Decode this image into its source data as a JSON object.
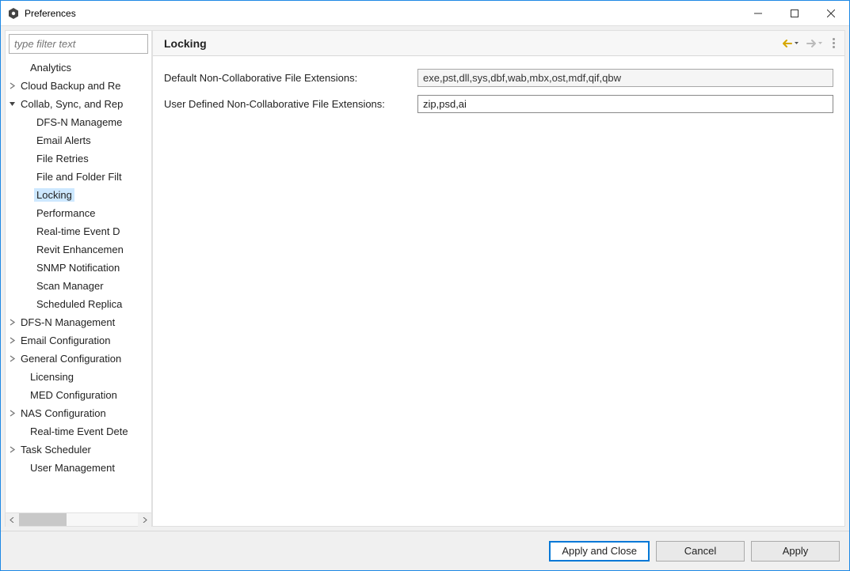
{
  "window": {
    "title": "Preferences"
  },
  "sidebar": {
    "filter_placeholder": "type filter text",
    "items": [
      {
        "label": "Analytics",
        "level": 0,
        "children": false,
        "expanded": false,
        "selected": false
      },
      {
        "label": "Cloud Backup and Re",
        "level": 0,
        "children": true,
        "expanded": false,
        "selected": false
      },
      {
        "label": "Collab, Sync, and Rep",
        "level": 0,
        "children": true,
        "expanded": true,
        "selected": false
      },
      {
        "label": "DFS-N Manageme",
        "level": 1,
        "children": false,
        "expanded": false,
        "selected": false
      },
      {
        "label": "Email Alerts",
        "level": 1,
        "children": false,
        "expanded": false,
        "selected": false
      },
      {
        "label": "File Retries",
        "level": 1,
        "children": false,
        "expanded": false,
        "selected": false
      },
      {
        "label": "File and Folder Filt",
        "level": 1,
        "children": false,
        "expanded": false,
        "selected": false
      },
      {
        "label": "Locking",
        "level": 1,
        "children": false,
        "expanded": false,
        "selected": true
      },
      {
        "label": "Performance",
        "level": 1,
        "children": false,
        "expanded": false,
        "selected": false
      },
      {
        "label": "Real-time Event D",
        "level": 1,
        "children": false,
        "expanded": false,
        "selected": false
      },
      {
        "label": "Revit Enhancemen",
        "level": 1,
        "children": false,
        "expanded": false,
        "selected": false
      },
      {
        "label": "SNMP Notification",
        "level": 1,
        "children": false,
        "expanded": false,
        "selected": false
      },
      {
        "label": "Scan Manager",
        "level": 1,
        "children": false,
        "expanded": false,
        "selected": false
      },
      {
        "label": "Scheduled Replica",
        "level": 1,
        "children": false,
        "expanded": false,
        "selected": false
      },
      {
        "label": "DFS-N Management",
        "level": 0,
        "children": true,
        "expanded": false,
        "selected": false
      },
      {
        "label": "Email Configuration",
        "level": 0,
        "children": true,
        "expanded": false,
        "selected": false
      },
      {
        "label": "General Configuration",
        "level": 0,
        "children": true,
        "expanded": false,
        "selected": false
      },
      {
        "label": "Licensing",
        "level": 0,
        "children": false,
        "expanded": false,
        "selected": false
      },
      {
        "label": "MED Configuration",
        "level": 0,
        "children": false,
        "expanded": false,
        "selected": false
      },
      {
        "label": "NAS Configuration",
        "level": 0,
        "children": true,
        "expanded": false,
        "selected": false
      },
      {
        "label": "Real-time Event Dete",
        "level": 0,
        "children": false,
        "expanded": false,
        "selected": false
      },
      {
        "label": "Task Scheduler",
        "level": 0,
        "children": true,
        "expanded": false,
        "selected": false
      },
      {
        "label": "User Management",
        "level": 0,
        "children": false,
        "expanded": false,
        "selected": false
      }
    ]
  },
  "panel": {
    "title": "Locking",
    "field1_label": "Default Non-Collaborative File Extensions:",
    "field1_value": "exe,pst,dll,sys,dbf,wab,mbx,ost,mdf,qif,qbw",
    "field2_label": "User Defined Non-Collaborative File Extensions:",
    "field2_value": "zip,psd,ai"
  },
  "buttons": {
    "apply_close": "Apply and Close",
    "cancel": "Cancel",
    "apply": "Apply"
  }
}
